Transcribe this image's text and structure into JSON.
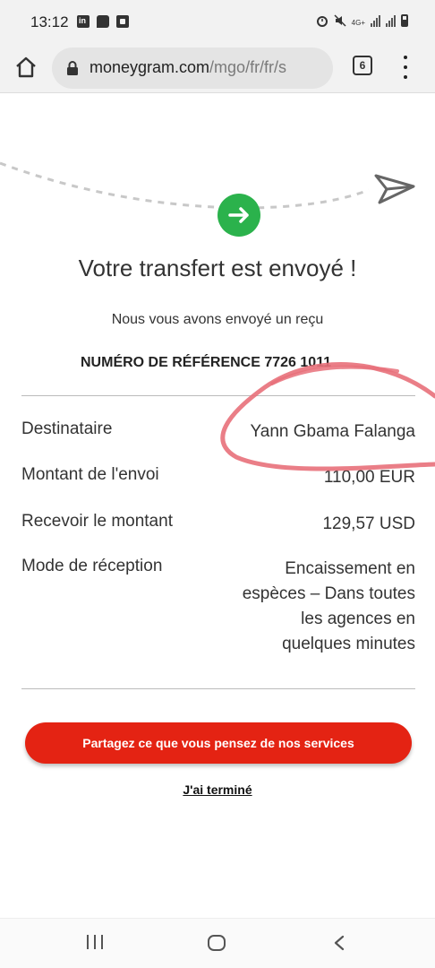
{
  "status_bar": {
    "time": "13:12",
    "network_label": "4G+"
  },
  "browser": {
    "url_domain": "moneygram.com",
    "url_path": "/mgo/fr/fr/s",
    "tab_count": "6"
  },
  "confirmation": {
    "title": "Votre transfert est envoyé !",
    "subtitle": "Nous vous avons envoyé un reçu",
    "reference_label": "NUMÉRO DE RÉFÉRENCE 7726 1011"
  },
  "details": [
    {
      "label": "Destinataire",
      "value": "Yann Gbama Falanga"
    },
    {
      "label": "Montant de l'envoi",
      "value": "110,00 EUR"
    },
    {
      "label": "Recevoir le montant",
      "value": "129,57 USD"
    },
    {
      "label": "Mode de réception",
      "value": "Encaissement en espèces – Dans toutes les agences en quelques minutes"
    }
  ],
  "actions": {
    "feedback_button": "Partagez ce que vous pensez de nos services",
    "done_link": "J'ai terminé"
  },
  "colors": {
    "accent_red": "#e42313",
    "success_green": "#2bb24c",
    "annotation_pink": "#e8707a"
  },
  "icons": {
    "home": "home-icon",
    "lock": "lock-icon",
    "menu": "more-vert-icon",
    "check": "arrow-right-icon",
    "plane": "paper-plane-icon"
  }
}
